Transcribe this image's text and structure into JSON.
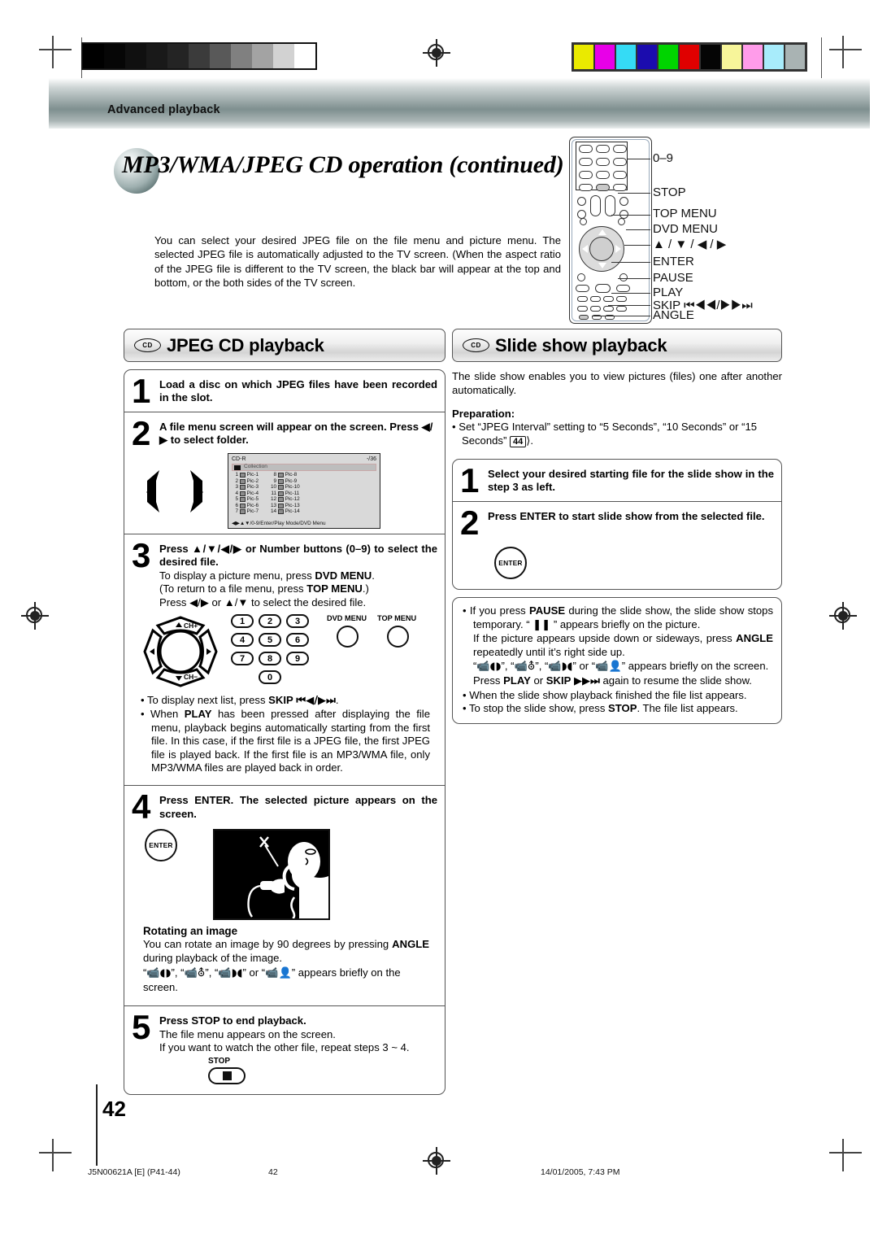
{
  "header": {
    "section_label": "Advanced playback"
  },
  "title": "MP3/WMA/JPEG CD operation (continued)",
  "intro": "You can select your desired JPEG file on the file menu and picture menu. The selected JPEG file is automatically adjusted to the TV screen. (When the aspect ratio of the JPEG file is different to the TV screen, the black bar will appear at the top and bottom, or the both sides of the TV screen.",
  "remote_callouts": [
    "0–9",
    "STOP",
    "TOP MENU",
    "DVD MENU",
    "▲ / ▼ / ◀ / ▶",
    "ENTER",
    "PAUSE",
    "PLAY",
    "SKIP ⏮◀◀/▶▶⏭",
    "ANGLE"
  ],
  "left_column": {
    "badge": "CD",
    "heading": "JPEG CD playback",
    "steps": [
      {
        "num": "1",
        "bold": "Load a disc on which JPEG files have been recorded in the slot."
      },
      {
        "num": "2",
        "bold": "A file menu screen will appear on the screen. Press ◀/▶ to select folder."
      },
      {
        "num": "3",
        "bold": "Press ▲/▼/◀/▶ or Number buttons (0–9) to select the desired file.",
        "lines": [
          "To display a picture menu, press DVD MENU.",
          "(To return to a file menu, press TOP MENU.)",
          "Press ◀/▶ or ▲/▼ to select the desired file."
        ],
        "emphasis": [
          "DVD MENU",
          "TOP MENU"
        ]
      },
      {
        "num": "4",
        "bold": "Press ENTER. The selected picture appears on the screen."
      },
      {
        "num": "5",
        "bold": "Press STOP to end playback.",
        "lines": [
          "The file menu appears on the screen.",
          "If you want to watch the other file, repeat steps 3 ~ 4."
        ]
      }
    ],
    "osd": {
      "disc_label": "CD-R",
      "counter": "-/36",
      "folder": "Collection",
      "files_left": [
        {
          "n": "1",
          "name": "Pic-1"
        },
        {
          "n": "2",
          "name": "Pic-2"
        },
        {
          "n": "3",
          "name": "Pic-3"
        },
        {
          "n": "4",
          "name": "Pic-4"
        },
        {
          "n": "5",
          "name": "Pic-5"
        },
        {
          "n": "6",
          "name": "Pic-6"
        },
        {
          "n": "7",
          "name": "Pic-7"
        }
      ],
      "files_right": [
        {
          "n": "8",
          "name": "Pic-8"
        },
        {
          "n": "9",
          "name": "Pic-9"
        },
        {
          "n": "10",
          "name": "Pic-10"
        },
        {
          "n": "11",
          "name": "Pic-11"
        },
        {
          "n": "12",
          "name": "Pic-12"
        },
        {
          "n": "13",
          "name": "Pic-13"
        },
        {
          "n": "14",
          "name": "Pic-14"
        }
      ],
      "footer_hint": "◀▶▲▼/0-9/Enter/Play Mode/DVD Menu"
    },
    "wheel_labels": {
      "up": "▲CH+",
      "down": "▼CH−",
      "left": "◀",
      "right": "▶"
    },
    "numkeys": [
      "1",
      "2",
      "3",
      "4",
      "5",
      "6",
      "7",
      "8",
      "9",
      "0"
    ],
    "menu_buttons": [
      "DVD MENU",
      "TOP MENU"
    ],
    "bullets": [
      "To display next list, press SKIP ⏮◀/▶⏭.",
      "When PLAY has been pressed after displaying the file menu, playback begins automatically starting from the first file. In this case, if the first file is a JPEG file, the first JPEG file is played back. If the first file is an MP3/WMA file, only MP3/WMA files are played back in order."
    ],
    "enter_label": "ENTER",
    "stop_label": "STOP",
    "rotating": {
      "heading": "Rotating an image",
      "lines": [
        "You can rotate an image by 90 degrees by pressing ANGLE during playback of the image.",
        "“📹◖◗”, “📹⛢”, “📹◗◖” or “📹👤” appears briefly on the screen."
      ]
    }
  },
  "right_column": {
    "badge": "CD",
    "heading": "Slide show playback",
    "intro": "The slide show enables you to view pictures (files) one after another automatically.",
    "preparation_heading": "Preparation:",
    "preparation_bullet": "Set “JPEG Interval” setting to “5 Seconds”, “10 Seconds” or “15 Seconds”",
    "preparation_ref": "44",
    "steps": [
      {
        "num": "1",
        "bold": "Select your desired starting file for the slide show in the step 3 as left."
      },
      {
        "num": "2",
        "bold": "Press ENTER to start slide show from the selected file."
      }
    ],
    "enter_label": "ENTER",
    "bullets": [
      "If you press PAUSE during the slide show, the slide show stops temporary. “ ❚❚ ” appears briefly on the picture.",
      "If the picture appears upside down or sideways, press ANGLE repeatedly until it’s right side up.",
      "“📹◖◗”, “📹⛢”, “📹◗◖” or “📹👤” appears briefly on the screen.",
      "Press PLAY or SKIP ▶▶⏭ again to resume the slide show.",
      "When the slide show playback finished the file list appears.",
      "To stop the slide show, press STOP. The file list appears."
    ]
  },
  "page_number": "42",
  "footer": {
    "left": "J5N00621A [E] (P41-44)",
    "center": "42",
    "right": "14/01/2005, 7:43 PM"
  },
  "colors": {
    "band": "#7e8f8f",
    "grayscale_bar": [
      "#000000",
      "#060606",
      "#101010",
      "#191919",
      "#242424",
      "#3b3b3b",
      "#595959",
      "#808080",
      "#a3a3a3",
      "#d2d2d2",
      "#ffffff"
    ],
    "color_bar": [
      "#eaea00",
      "#e800e8",
      "#35dbf5",
      "#1b0cae",
      "#00d400",
      "#e00000",
      "#050505",
      "#f7f59a",
      "#ff9cea",
      "#a8ecfb",
      "#a9b3b3"
    ]
  }
}
